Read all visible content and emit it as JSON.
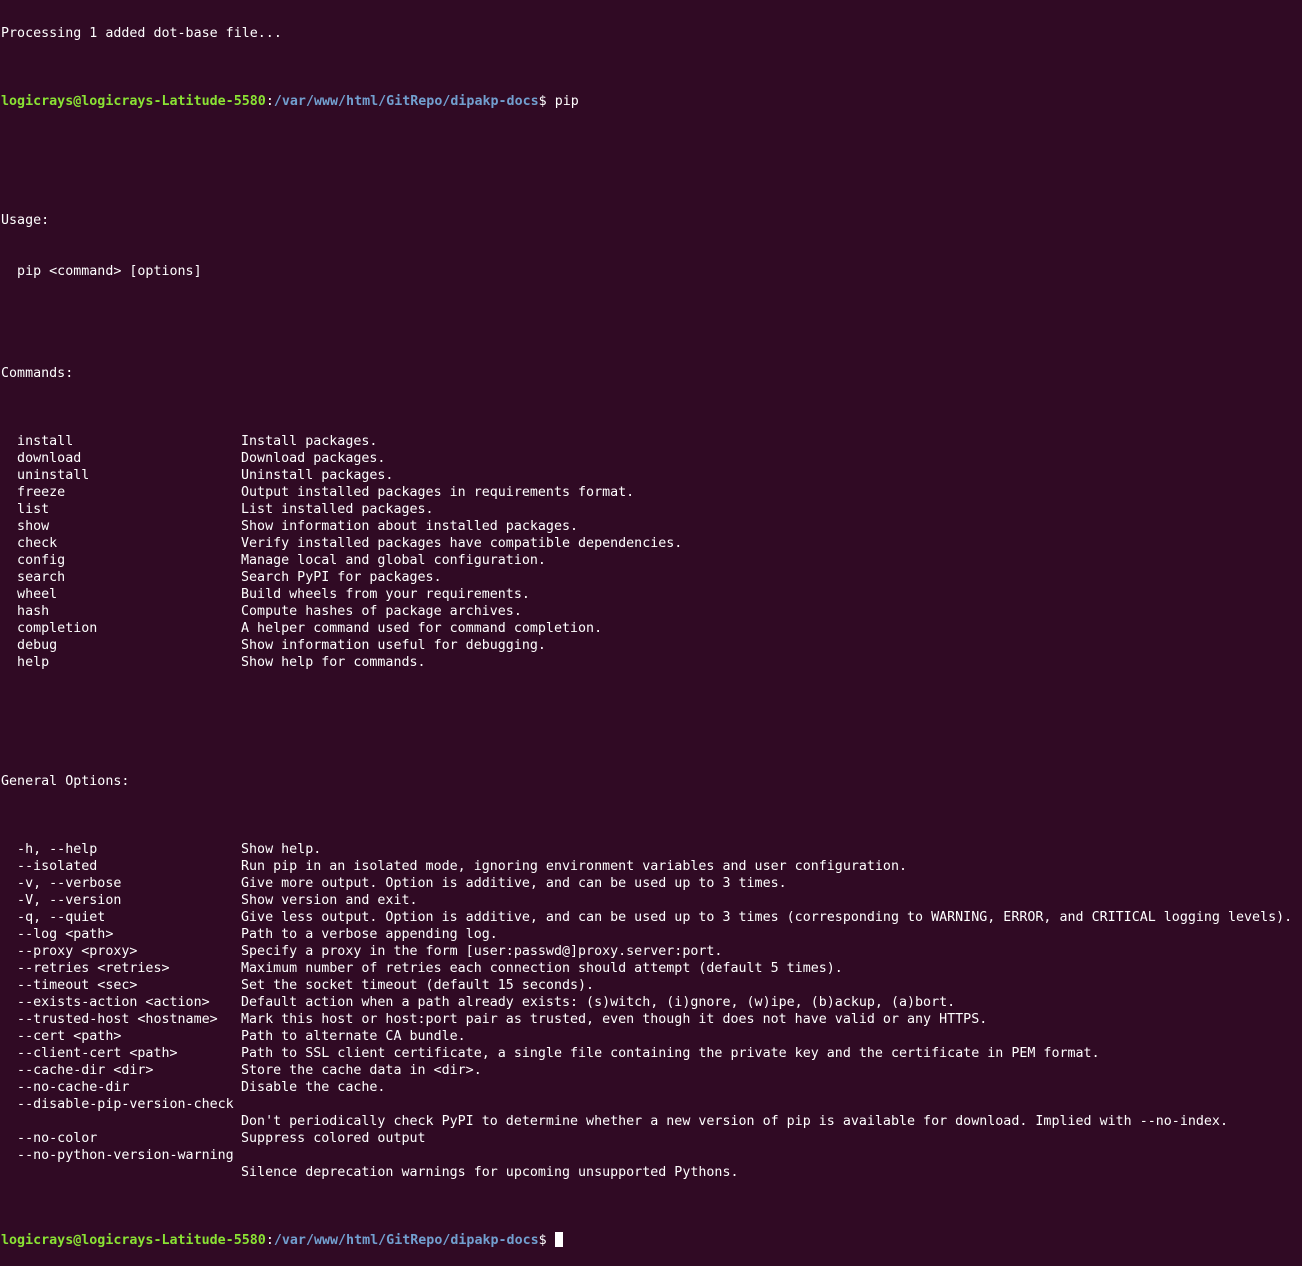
{
  "terminal": {
    "top_partial_line": "Processing 1 added dot-base file...",
    "prompt": {
      "user_host": "logicrays@logicrays-Latitude-5580",
      "sep": ":",
      "path": "/var/www/html/GitRepo/dipakp-docs",
      "symbol": "$ ",
      "command": "pip"
    },
    "usage_header": "Usage:",
    "usage_line": "  pip <command> [options]",
    "commands_header": "Commands:",
    "commands": [
      {
        "name": "  install",
        "desc": "Install packages."
      },
      {
        "name": "  download",
        "desc": "Download packages."
      },
      {
        "name": "  uninstall",
        "desc": "Uninstall packages."
      },
      {
        "name": "  freeze",
        "desc": "Output installed packages in requirements format."
      },
      {
        "name": "  list",
        "desc": "List installed packages."
      },
      {
        "name": "  show",
        "desc": "Show information about installed packages."
      },
      {
        "name": "  check",
        "desc": "Verify installed packages have compatible dependencies."
      },
      {
        "name": "  config",
        "desc": "Manage local and global configuration."
      },
      {
        "name": "  search",
        "desc": "Search PyPI for packages."
      },
      {
        "name": "  wheel",
        "desc": "Build wheels from your requirements."
      },
      {
        "name": "  hash",
        "desc": "Compute hashes of package archives."
      },
      {
        "name": "  completion",
        "desc": "A helper command used for command completion."
      },
      {
        "name": "  debug",
        "desc": "Show information useful for debugging."
      },
      {
        "name": "  help",
        "desc": "Show help for commands."
      }
    ],
    "general_header": "General Options:",
    "options": [
      {
        "name": "  -h, --help",
        "desc": "Show help."
      },
      {
        "name": "  --isolated",
        "desc": "Run pip in an isolated mode, ignoring environment variables and user configuration."
      },
      {
        "name": "  -v, --verbose",
        "desc": "Give more output. Option is additive, and can be used up to 3 times."
      },
      {
        "name": "  -V, --version",
        "desc": "Show version and exit."
      },
      {
        "name": "  -q, --quiet",
        "desc": "Give less output. Option is additive, and can be used up to 3 times (corresponding to WARNING, ERROR, and CRITICAL logging levels)."
      },
      {
        "name": "  --log <path>",
        "desc": "Path to a verbose appending log."
      },
      {
        "name": "  --proxy <proxy>",
        "desc": "Specify a proxy in the form [user:passwd@]proxy.server:port."
      },
      {
        "name": "  --retries <retries>",
        "desc": "Maximum number of retries each connection should attempt (default 5 times)."
      },
      {
        "name": "  --timeout <sec>",
        "desc": "Set the socket timeout (default 15 seconds)."
      },
      {
        "name": "  --exists-action <action>",
        "desc": "Default action when a path already exists: (s)witch, (i)gnore, (w)ipe, (b)ackup, (a)bort."
      },
      {
        "name": "  --trusted-host <hostname>",
        "desc": "Mark this host or host:port pair as trusted, even though it does not have valid or any HTTPS."
      },
      {
        "name": "  --cert <path>",
        "desc": "Path to alternate CA bundle."
      },
      {
        "name": "  --client-cert <path>",
        "desc": "Path to SSL client certificate, a single file containing the private key and the certificate in PEM format."
      },
      {
        "name": "  --cache-dir <dir>",
        "desc": "Store the cache data in <dir>."
      },
      {
        "name": "  --no-cache-dir",
        "desc": "Disable the cache."
      },
      {
        "name": "  --disable-pip-version-check",
        "desc": ""
      },
      {
        "name": "",
        "desc": "Don't periodically check PyPI to determine whether a new version of pip is available for download. Implied with --no-index."
      },
      {
        "name": "  --no-color",
        "desc": "Suppress colored output"
      },
      {
        "name": "  --no-python-version-warning",
        "desc": ""
      },
      {
        "name": "",
        "desc": "Silence deprecation warnings for upcoming unsupported Pythons."
      }
    ],
    "colors": {
      "background": "#300a24",
      "foreground": "#ffffff",
      "user_host": "#8ae234",
      "path": "#729fcf"
    }
  }
}
